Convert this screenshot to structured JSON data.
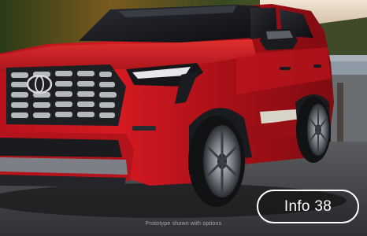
{
  "video": {
    "disclaimer": "Prototype shown with options",
    "info_button_label": "Info 38",
    "vehicle_color": "#c3141a",
    "background_colors": {
      "forest": "#3a4a22",
      "sky": "#d9c7b3",
      "lake": "#8b98a4",
      "road": "#4a4a4f"
    }
  }
}
